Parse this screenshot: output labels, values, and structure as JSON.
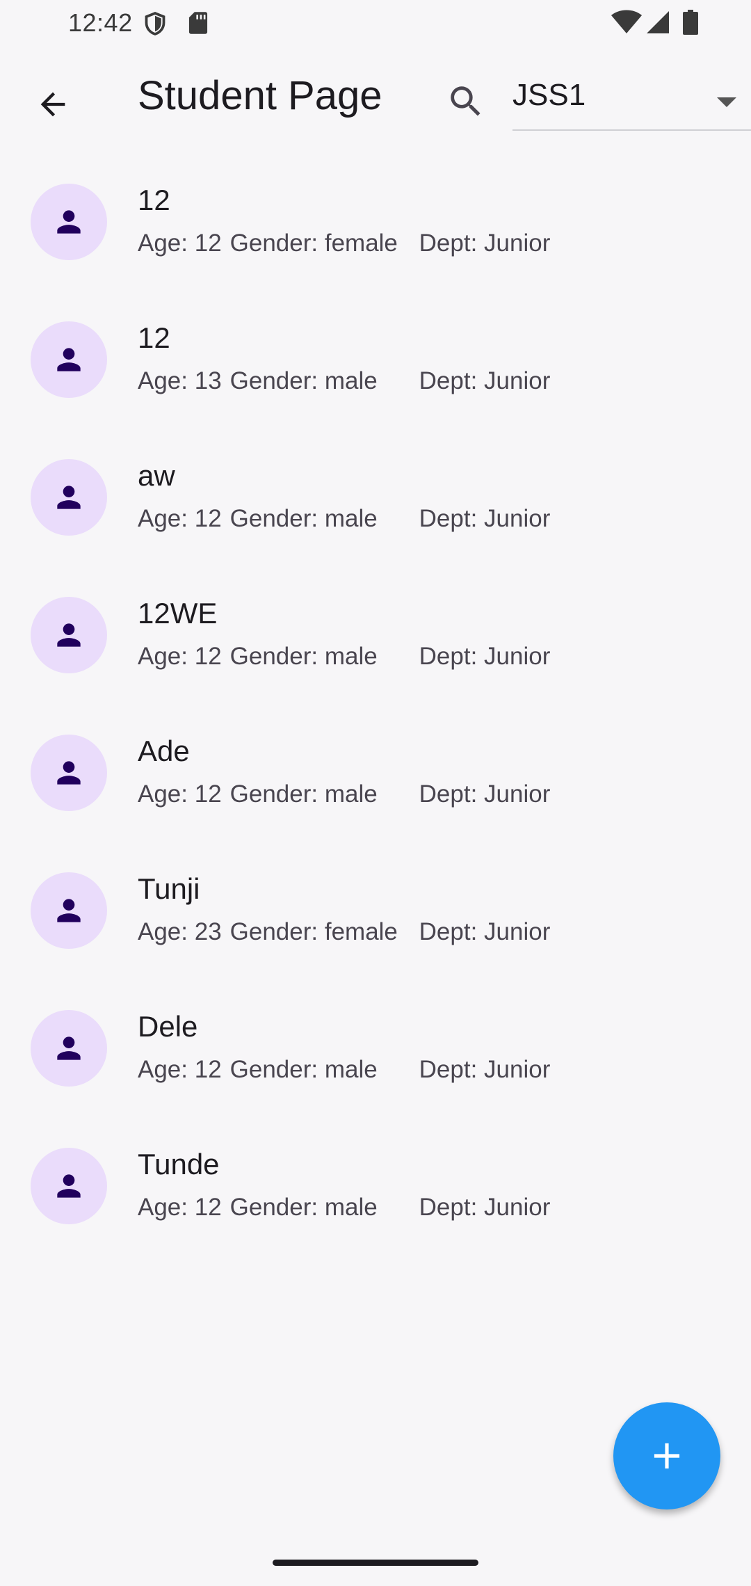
{
  "status_bar": {
    "time": "12:42",
    "icons": [
      "shield-icon",
      "sd-card-icon",
      "wifi-icon",
      "signal-icon",
      "battery-icon"
    ]
  },
  "app_bar": {
    "back_icon": "arrow-back-icon",
    "title": "Student Page",
    "search_icon": "search-icon",
    "class_dropdown": {
      "selected": "JSS1"
    }
  },
  "students": [
    {
      "name": "12",
      "age": "Age: 12",
      "gender": "Gender: female",
      "dept": "Dept: Junior"
    },
    {
      "name": "12",
      "age": "Age: 13",
      "gender": "Gender: male",
      "dept": "Dept: Junior"
    },
    {
      "name": "aw",
      "age": "Age: 12",
      "gender": "Gender: male",
      "dept": "Dept: Junior"
    },
    {
      "name": "12WE",
      "age": "Age: 12",
      "gender": "Gender: male",
      "dept": "Dept: Junior"
    },
    {
      "name": "Ade",
      "age": "Age: 12",
      "gender": "Gender: male",
      "dept": "Dept: Junior"
    },
    {
      "name": "Tunji",
      "age": "Age: 23",
      "gender": "Gender: female",
      "dept": "Dept: Junior"
    },
    {
      "name": "Dele",
      "age": "Age: 12",
      "gender": "Gender: male",
      "dept": "Dept: Junior"
    },
    {
      "name": "Tunde",
      "age": "Age: 12",
      "gender": "Gender: male",
      "dept": "Dept: Junior"
    }
  ],
  "fab": {
    "icon": "add-icon"
  },
  "colors": {
    "background": "#f7f6f8",
    "avatar_bg": "#eadcfb",
    "avatar_icon": "#21005d",
    "fab": "#2196f3"
  }
}
